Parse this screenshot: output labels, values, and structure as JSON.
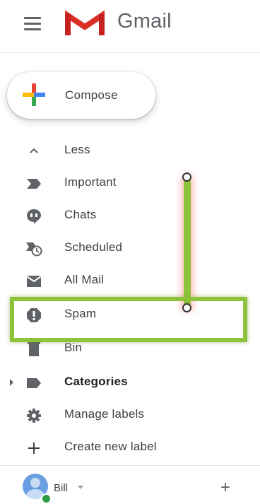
{
  "header": {
    "app_title": "Gmail",
    "menu_icon": "hamburger-icon",
    "logo_icon": "gmail-logo-icon"
  },
  "compose": {
    "label": "Compose",
    "icon": "plus-icon"
  },
  "nav": {
    "items": [
      {
        "label": "Less",
        "icon": "chevron-up-icon"
      },
      {
        "label": "Important",
        "icon": "important-icon"
      },
      {
        "label": "Chats",
        "icon": "chat-icon"
      },
      {
        "label": "Scheduled",
        "icon": "scheduled-icon"
      },
      {
        "label": "All Mail",
        "icon": "mail-icon"
      },
      {
        "label": "Spam",
        "icon": "spam-icon"
      },
      {
        "label": "Bin",
        "icon": "bin-icon"
      },
      {
        "label": "Categories",
        "icon": "label-icon"
      },
      {
        "label": "Manage labels",
        "icon": "gear-icon"
      },
      {
        "label": "Create new label",
        "icon": "plus-icon"
      }
    ]
  },
  "account": {
    "name": "Bill",
    "add_icon": "plus-icon"
  },
  "colors": {
    "highlight": "#8fc23b",
    "gmail_red": "#d93025",
    "status_green": "#2e9c45"
  }
}
